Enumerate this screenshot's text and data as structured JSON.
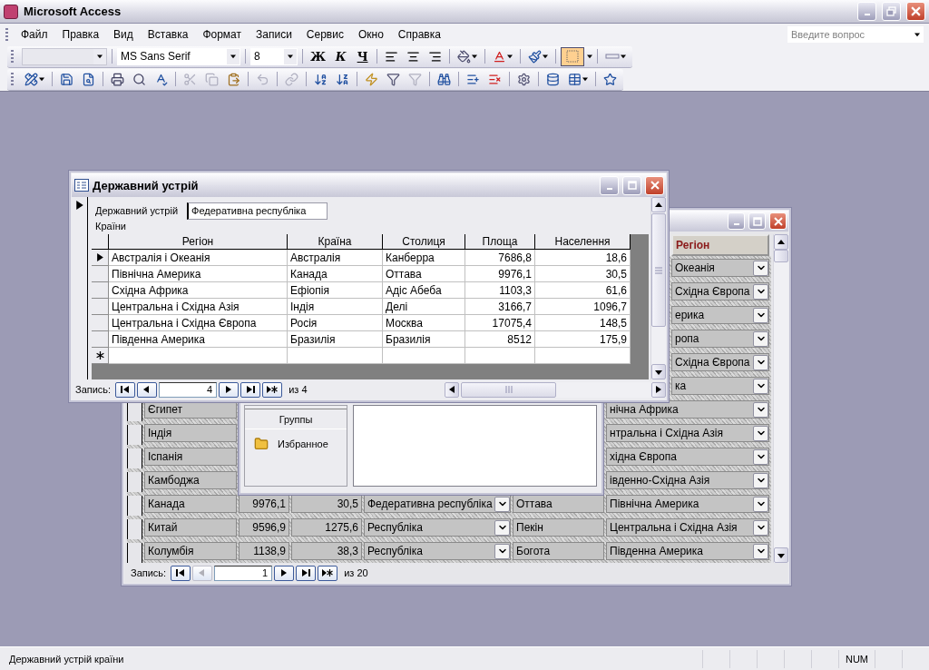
{
  "app": {
    "title": "Microsoft Access"
  },
  "menu": [
    {
      "label": "Файл"
    },
    {
      "label": "Правка"
    },
    {
      "label": "Вид"
    },
    {
      "label": "Вставка"
    },
    {
      "label": "Формат"
    },
    {
      "label": "Записи"
    },
    {
      "label": "Сервис"
    },
    {
      "label": "Окно"
    },
    {
      "label": "Справка"
    }
  ],
  "help_box": {
    "placeholder": "Введите вопрос"
  },
  "format_toolbar": {
    "font": "MS Sans Serif",
    "size": "8",
    "style_buttons": [
      {
        "label": "Ж",
        "kind": "bold"
      },
      {
        "label": "К",
        "kind": "italic"
      },
      {
        "label": "Ч",
        "kind": "underline"
      }
    ],
    "border_button": {
      "selected": true
    }
  },
  "back_form": {
    "region_header": "Регіон",
    "rows": [
      {
        "region": "Океанія"
      },
      {
        "region": "Східна Європа"
      },
      {
        "region": "ерика"
      },
      {
        "region": "ропа"
      },
      {
        "region": "Східна Європа"
      },
      {
        "region": "ка"
      },
      {
        "country": "Єгипет",
        "region": "нічна Африка"
      },
      {
        "country": "Індія",
        "region": "нтральна і Східна Азія"
      },
      {
        "country": "Іспанія",
        "region": "хідна Європа"
      },
      {
        "country": "Камбоджа",
        "region": "івденно-Східна Азія"
      },
      {
        "country": "Канада",
        "area": "9976,1",
        "population": "30,5",
        "government": "Федеративна республіка",
        "capital": "Оттава",
        "region": "Північна Америка"
      },
      {
        "country": "Китай",
        "area": "9596,9",
        "population": "1275,6",
        "government": "Республіка",
        "capital": "Пекін",
        "region": "Центральна і Східна Азія"
      },
      {
        "country": "Колумбія",
        "area": "1138,9",
        "population": "38,3",
        "government": "Республіка",
        "capital": "Богота",
        "region": "Південна Америка"
      }
    ],
    "navigator": {
      "label": "Запись:",
      "current": "1",
      "total": "из 20",
      "previous_disabled": true
    }
  },
  "database_window": {
    "groups_label": "Группы",
    "groups": [
      {
        "label": "Избранное"
      }
    ]
  },
  "front_form": {
    "title": "Державний устрій",
    "field": {
      "label": "Державний устрій",
      "value": "Федеративна республіка"
    },
    "subform_label": "Країни",
    "subform": {
      "columns": [
        {
          "title": "Регіон",
          "kind": "text"
        },
        {
          "title": "Країна",
          "kind": "text"
        },
        {
          "title": "Столиця",
          "kind": "text"
        },
        {
          "title": "Площа",
          "kind": "number"
        },
        {
          "title": "Населення",
          "kind": "number"
        }
      ],
      "rows": [
        {
          "cells": [
            "Австралія і Океанія",
            "Австралія",
            "Канберра",
            "7686,8",
            "18,6"
          ],
          "selected": true
        },
        {
          "cells": [
            "Північна Америка",
            "Канада",
            "Оттава",
            "9976,1",
            "30,5"
          ],
          "selected": false
        },
        {
          "cells": [
            "Східна Африка",
            "Ефіопія",
            "Адіс Абеба",
            "1103,3",
            "61,6"
          ],
          "selected": false
        },
        {
          "cells": [
            "Центральна і Східна Азія",
            "Індія",
            "Делі",
            "3166,7",
            "1096,7"
          ],
          "selected": false
        },
        {
          "cells": [
            "Центральна і Східна Європа",
            "Росія",
            "Москва",
            "17075,4",
            "148,5"
          ],
          "selected": false
        },
        {
          "cells": [
            "Південна Америка",
            "Бразилія",
            "Бразилія",
            "8512",
            "175,9"
          ],
          "selected": false
        }
      ]
    },
    "navigator": {
      "label": "Запись:",
      "current": "4",
      "total": "из 4",
      "previous_disabled": false
    }
  },
  "status_bar": {
    "text": "Державний устрій країни",
    "indicator": "NUM"
  }
}
